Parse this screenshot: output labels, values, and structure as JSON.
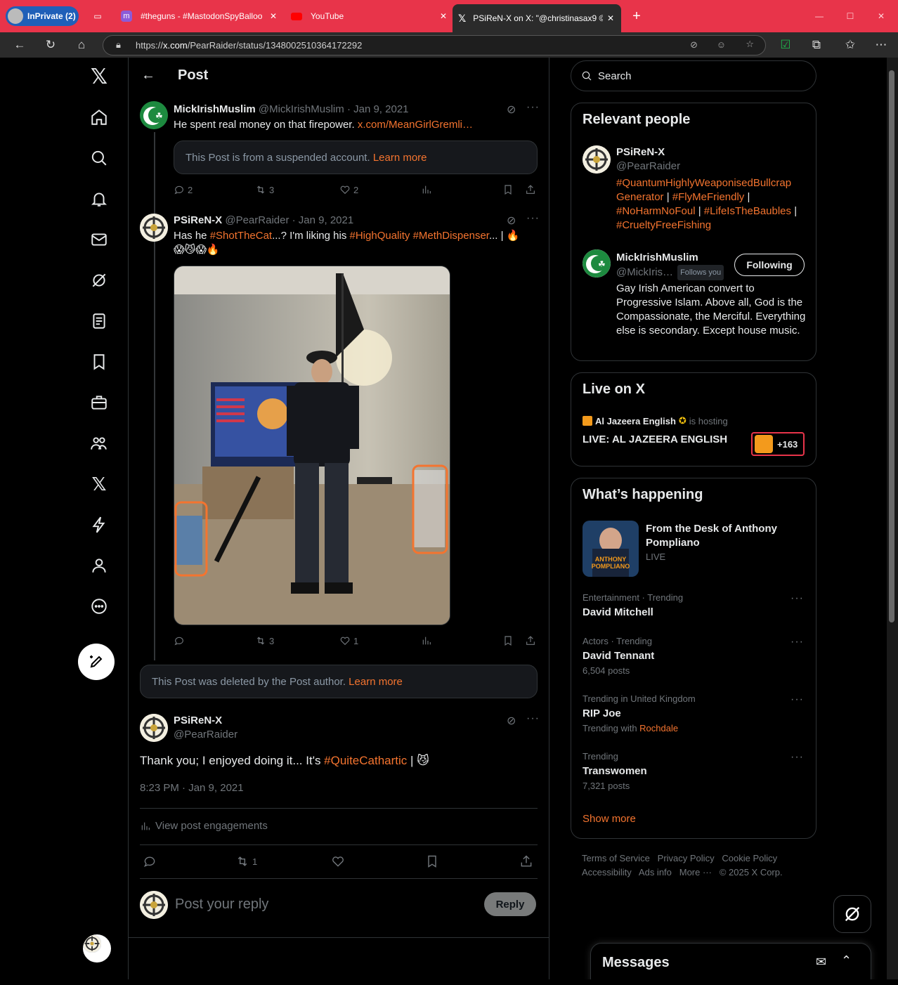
{
  "browser": {
    "inprivate_label": "InPrivate (2)",
    "tabs": [
      {
        "label": "#theguns - #MastodonSpyBalloo"
      },
      {
        "label": "YouTube"
      },
      {
        "label": "PSiReN-X on X: \"@christinasax9 ©"
      }
    ],
    "url_prefix": "https://",
    "url_host": "x.com",
    "url_path": "/PearRaider/status/1348002510364172292"
  },
  "header": {
    "title": "Post"
  },
  "thread": {
    "post1": {
      "name": "MickIrishMuslim",
      "handle": "@MickIrishMuslim",
      "date": "· Jan 9, 2021",
      "text": "He spent real money on that firepower.",
      "link": "x.com/MeanGirlGremli…",
      "suspended_text": "This Post is from a suspended account.",
      "suspended_link": "Learn more",
      "replies": "2",
      "reposts": "3",
      "likes": "2"
    },
    "post2": {
      "name": "PSiReN-X",
      "handle": "@PearRaider",
      "date": "· Jan 9, 2021",
      "text_a": "Has he ",
      "tag1": "#ShotTheCat",
      "text_b": "...? I'm liking his ",
      "tag2": "#HighQuality",
      "tag3": "#MethDispenser",
      "text_c": "... | 🔥",
      "emoji_line": "😱😼😱🔥",
      "replies": "",
      "reposts": "3",
      "likes": "1"
    },
    "deleted_text": "This Post was deleted by the Post author.",
    "deleted_link": "Learn more",
    "main": {
      "name": "PSiReN-X",
      "handle": "@PearRaider",
      "text_a": "Thank you; I enjoyed doing it... It's ",
      "tag": "#QuiteCathartic",
      "text_b": " | 😼",
      "timestamp": "8:23 PM · Jan 9, 2021",
      "engagements": "View post engagements",
      "reposts": "1"
    },
    "reply_placeholder": "Post your reply",
    "reply_button": "Reply"
  },
  "sidebar": {
    "search_placeholder": "Search",
    "relevant": {
      "title": "Relevant people",
      "p1": {
        "name": "PSiReN-X",
        "handle": "@PearRaider",
        "bio": [
          {
            "t": "#QuantumHighlyWeaponisedBullcrap",
            "link": true
          },
          {
            "t": "Generator",
            "link": true
          },
          {
            "t": " | ",
            "link": false
          },
          {
            "t": "#FlyMeFriendly",
            "link": true
          },
          {
            "t": " |",
            "link": false
          },
          {
            "t": "#NoHarmNoFoul",
            "link": true
          },
          {
            "t": " | ",
            "link": false
          },
          {
            "t": "#LifeIsTheBaubles",
            "link": true
          },
          {
            "t": " |",
            "link": false
          },
          {
            "t": "#CrueltyFreeFishing",
            "link": true
          }
        ]
      },
      "p2": {
        "name": "MickIrishMuslim",
        "handle": "@MickIris…",
        "follows_you": "Follows you",
        "following": "Following",
        "bio": "Gay Irish American convert to Progressive Islam. Above all, God is the Compassionate, the Merciful. Everything else is secondary. Except house music."
      }
    },
    "live": {
      "title": "Live on X",
      "host": "Al Jazeera English",
      "hosting": "is hosting",
      "show": "LIVE: AL JAZEERA ENGLISH",
      "count": "+163"
    },
    "happening": {
      "title": "What’s happening",
      "featured": {
        "title": "From the Desk of Anthony Pompliano",
        "status": "LIVE",
        "thumb_text": "ANTHONY POMPLIANO"
      },
      "trends": [
        {
          "meta": "Entertainment · Trending",
          "name": "David Mitchell",
          "sub": ""
        },
        {
          "meta": "Actors · Trending",
          "name": "David Tennant",
          "sub": "6,504 posts"
        },
        {
          "meta": "Trending in United Kingdom",
          "name": "RIP Joe",
          "sub_prefix": "Trending with ",
          "sub_link": "Rochdale"
        },
        {
          "meta": "Trending",
          "name": "Transwomen",
          "sub": "7,321 posts"
        }
      ],
      "show_more": "Show more"
    },
    "footer": {
      "row1": [
        "Terms of Service",
        "Privacy Policy",
        "Cookie Policy"
      ],
      "row2": [
        "Accessibility",
        "Ads info",
        "More ···",
        "© 2025 X Corp."
      ]
    },
    "messages": "Messages"
  },
  "colors": {
    "accent": "#f4742f",
    "titlebar": "#e8344a",
    "border": "#2f3336"
  }
}
